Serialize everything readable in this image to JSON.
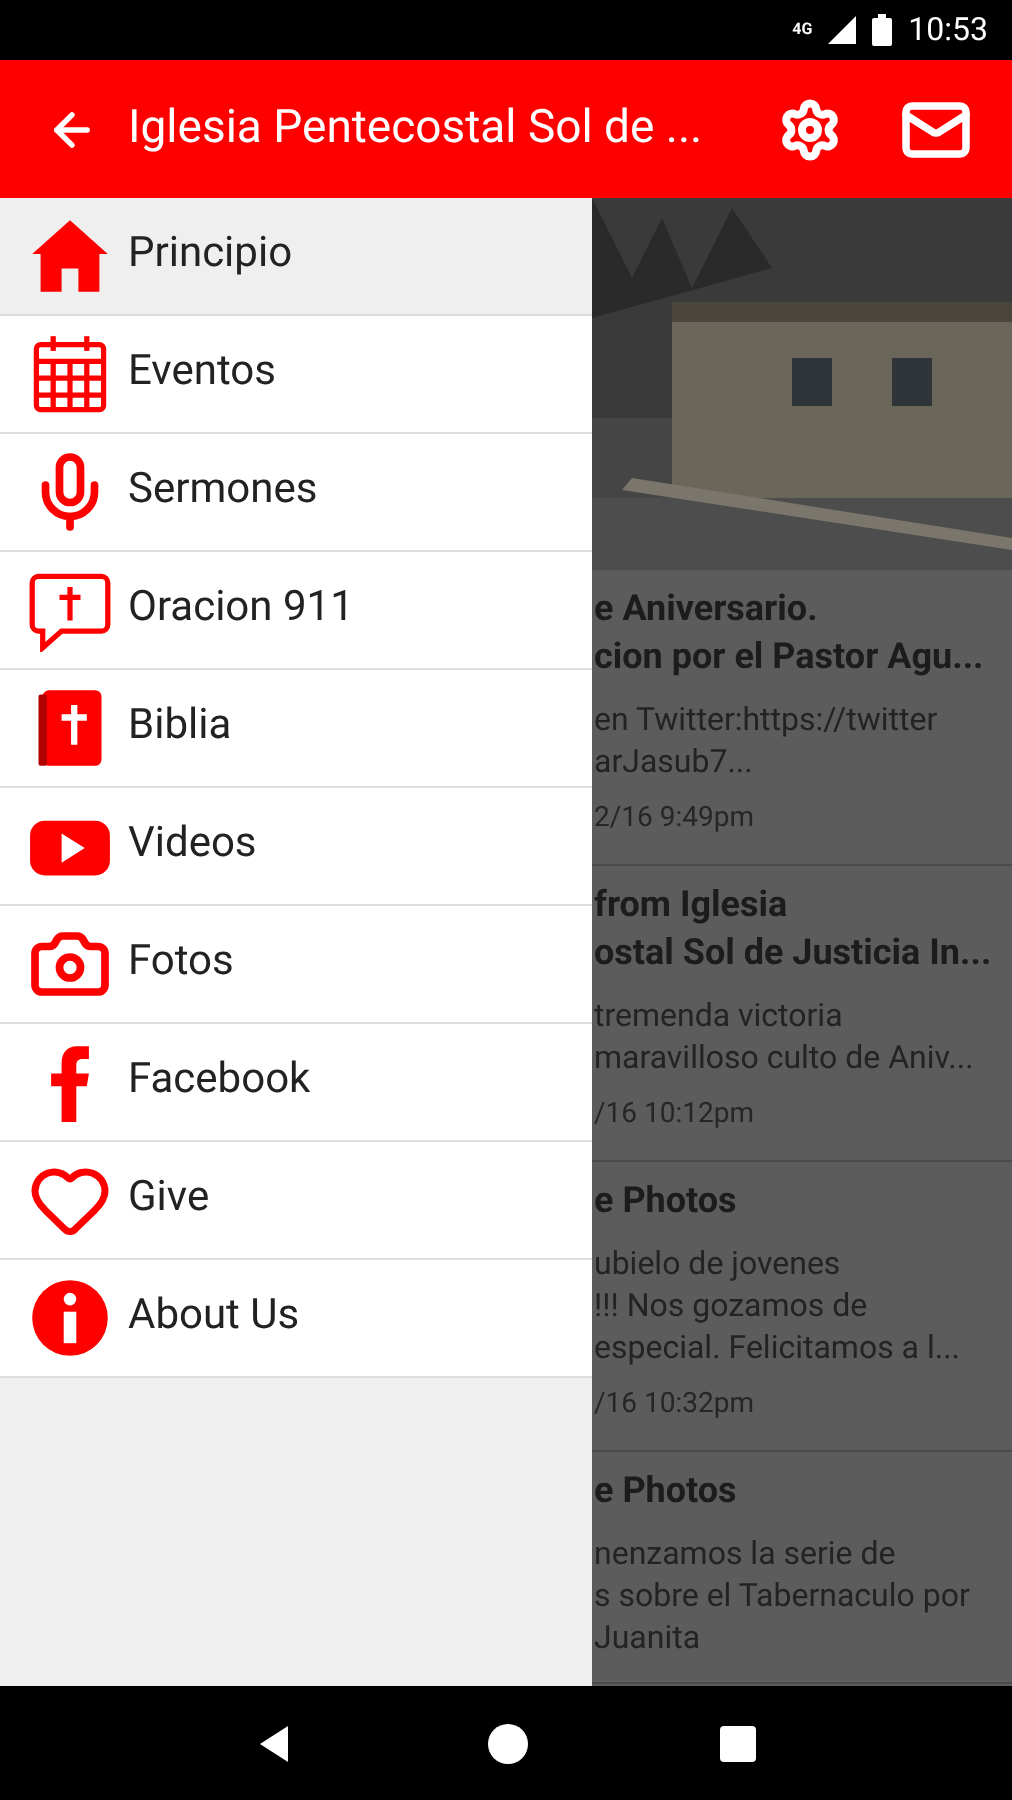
{
  "status_bar": {
    "network": "4G",
    "time": "10:53"
  },
  "app_bar": {
    "title": "Iglesia Pentecostal Sol de ..."
  },
  "drawer": {
    "items": [
      {
        "label": "Principio",
        "selected": true
      },
      {
        "label": "Eventos",
        "selected": false
      },
      {
        "label": "Sermones",
        "selected": false
      },
      {
        "label": "Oracion 911",
        "selected": false
      },
      {
        "label": "Biblia",
        "selected": false
      },
      {
        "label": "Videos",
        "selected": false
      },
      {
        "label": "Fotos",
        "selected": false
      },
      {
        "label": "Facebook",
        "selected": false
      },
      {
        "label": "Give",
        "selected": false
      },
      {
        "label": "About Us",
        "selected": false
      }
    ]
  },
  "feed": {
    "posts": [
      {
        "title": "e Aniversario.\ncion por el Pastor Agu...",
        "body": "en Twitter:https://twitter\narJasub7...",
        "date": "2/16 9:49pm"
      },
      {
        "title": "from Iglesia\nostal Sol de Justicia In...",
        "body": "tremenda victoria\nmaravilloso culto de Aniv...",
        "date": "/16 10:12pm"
      },
      {
        "title": "e Photos",
        "body": "ubielo de jovenes\n!!! Nos gozamos de\nespecial. Felicitamos a l...",
        "date": "/16 10:32pm"
      },
      {
        "title": "e Photos",
        "body": "nenzamos la serie de\ns sobre el Tabernaculo por\nJuanita"
      }
    ]
  }
}
